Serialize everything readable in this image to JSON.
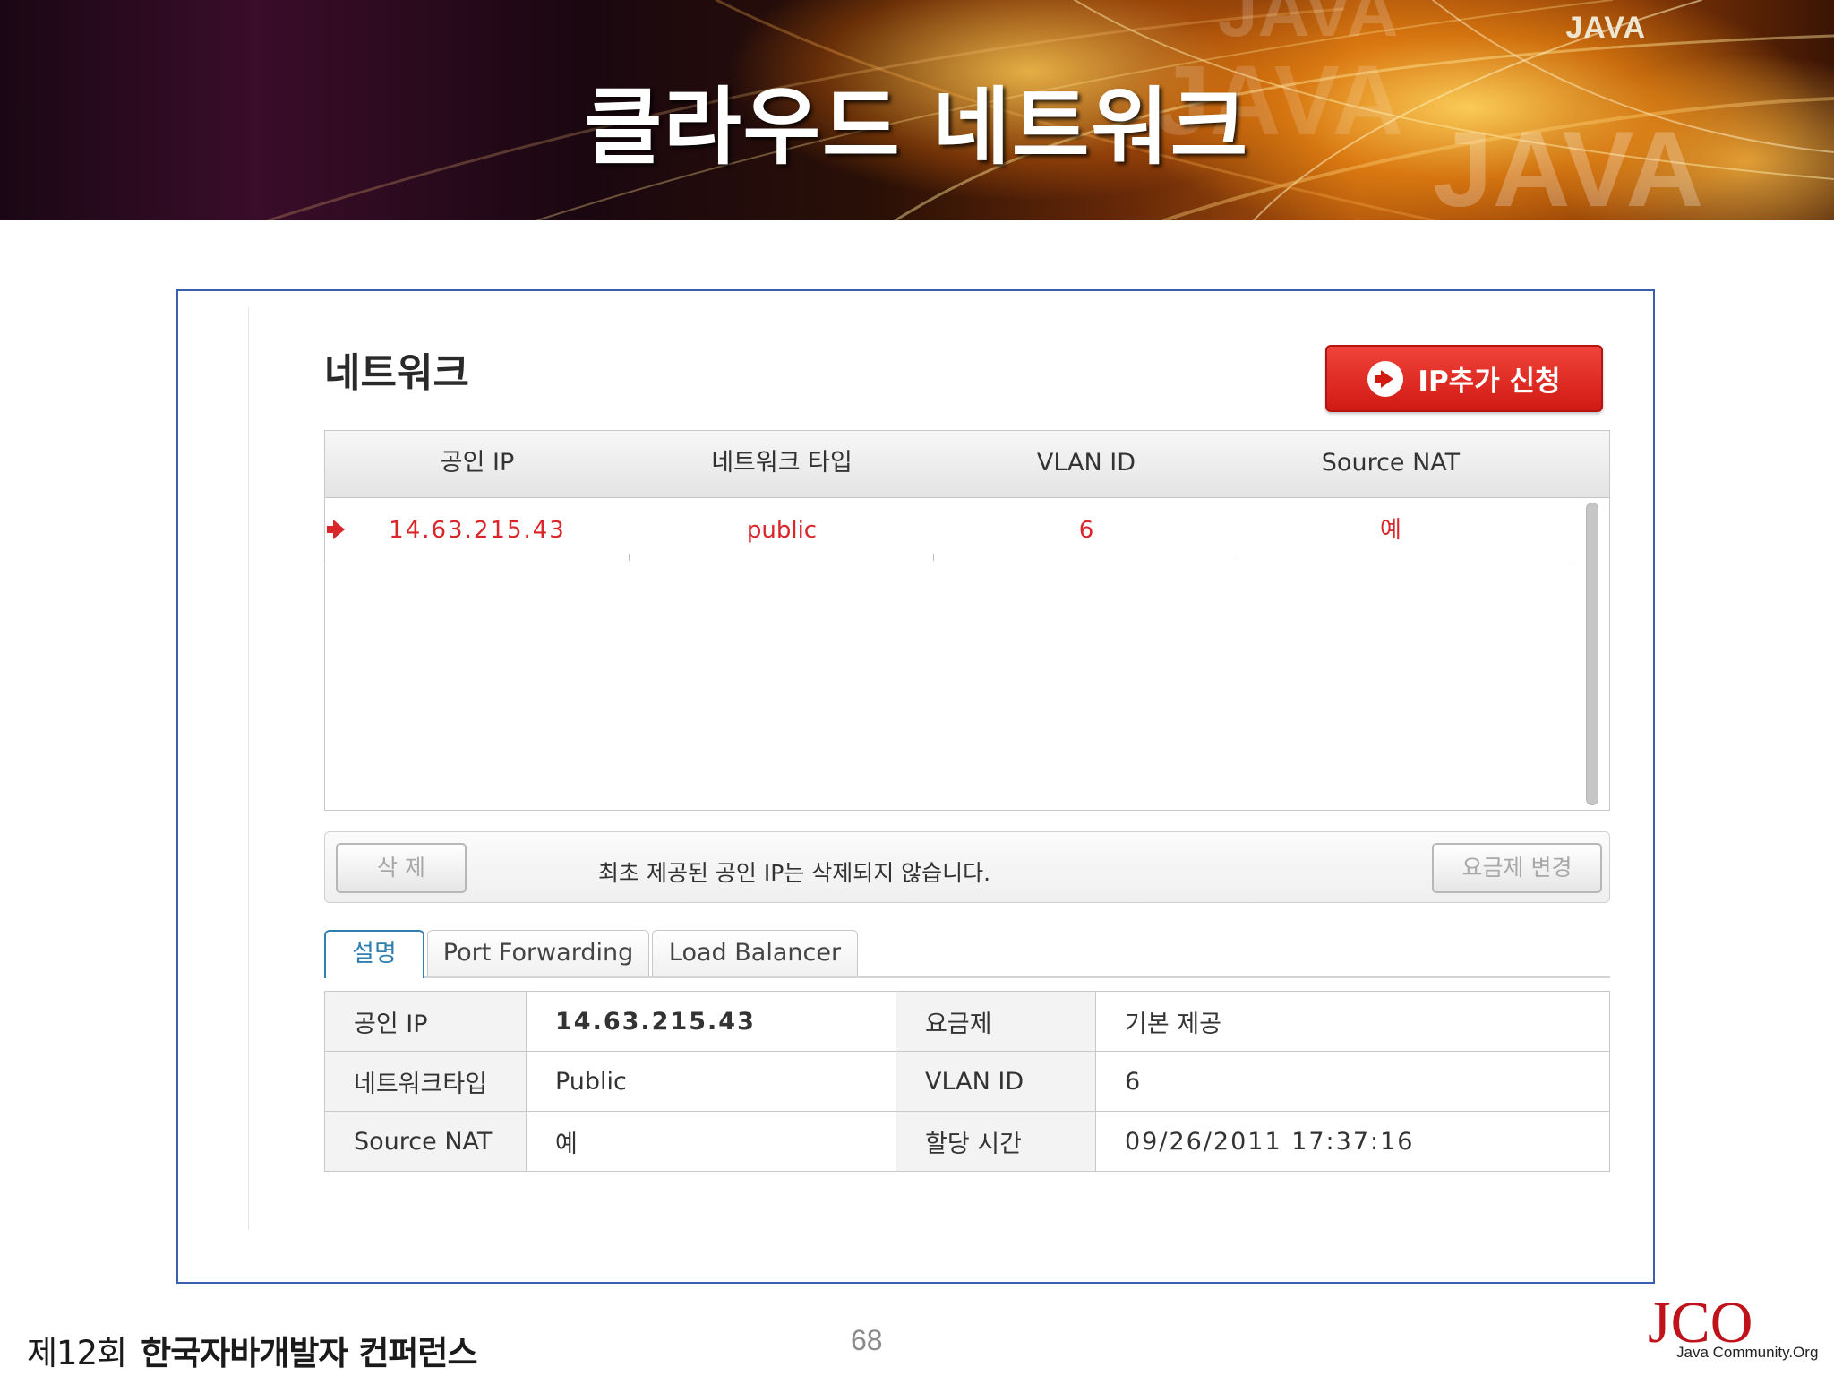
{
  "slide": {
    "title": "클라우드 네트워크",
    "banner_brand": "JAVA",
    "page_number": "68",
    "footer": {
      "event_prefix": "제12회",
      "event_name": "한국자바개발자 컨퍼런스"
    },
    "logo": {
      "mark": "JCO",
      "caption": "Java Community.Org"
    }
  },
  "panel": {
    "title": "네트워크",
    "add_ip_button": "IP추가 신청",
    "grid": {
      "columns": [
        "공인 IP",
        "네트워크 타입",
        "VLAN ID",
        "Source NAT"
      ],
      "rows": [
        {
          "public_ip": "14.63.215.43",
          "type": "public",
          "vlan_id": "6",
          "source_nat": "예",
          "selected": true
        }
      ]
    },
    "actions": {
      "delete_button": "삭 제",
      "note": "최초 제공된 공인 IP는 삭제되지 않습니다.",
      "change_plan_button": "요금제 변경"
    },
    "tabs": [
      {
        "label": "설명",
        "active": true
      },
      {
        "label": "Port Forwarding",
        "active": false
      },
      {
        "label": "Load Balancer",
        "active": false
      }
    ],
    "details": {
      "rows": [
        {
          "label1": "공인 IP",
          "value1": "14.63.215.43",
          "label2": "요금제",
          "value2": "기본 제공"
        },
        {
          "label1": "네트워크타입",
          "value1": "Public",
          "label2": "VLAN ID",
          "value2": "6"
        },
        {
          "label1": "Source NAT",
          "value1": "예",
          "label2": "할당 시간",
          "value2": "09/26/2011 17:37:16"
        }
      ]
    }
  },
  "colors": {
    "accent_red": "#d11a14",
    "row_text_red": "#d9262a",
    "active_tab_blue": "#2f7fb0",
    "frame_blue": "#3a5fb0"
  }
}
